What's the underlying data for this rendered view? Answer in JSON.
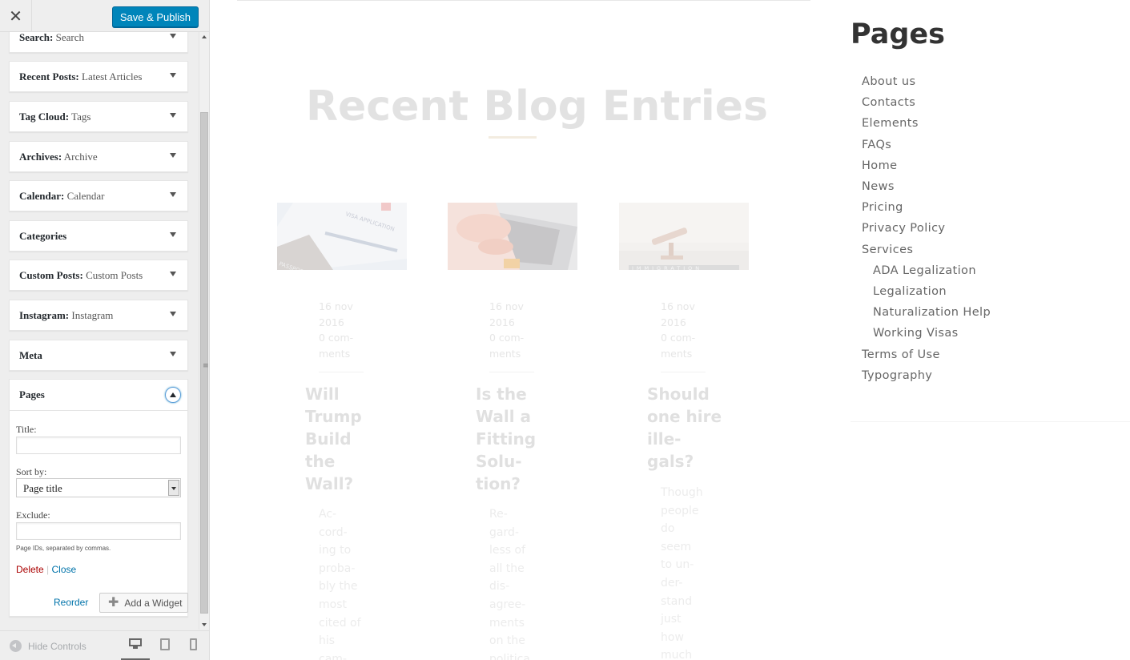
{
  "header": {
    "close_label": "✕",
    "publish_label": "Save & Publish"
  },
  "widgets": [
    {
      "title": "Search",
      "subtitle": "Search"
    },
    {
      "title": "Recent Posts",
      "subtitle": "Latest Articles"
    },
    {
      "title": "Tag Cloud",
      "subtitle": "Tags"
    },
    {
      "title": "Archives",
      "subtitle": "Archive"
    },
    {
      "title": "Calendar",
      "subtitle": "Calendar"
    },
    {
      "title": "Categories",
      "subtitle": ""
    },
    {
      "title": "Custom Posts",
      "subtitle": "Custom Posts"
    },
    {
      "title": "Instagram",
      "subtitle": "Instagram"
    },
    {
      "title": "Meta",
      "subtitle": ""
    }
  ],
  "pages_widget": {
    "title": "Pages",
    "title_label": "Title:",
    "title_value": "",
    "sort_label": "Sort by:",
    "sort_value": "Page title",
    "exclude_label": "Exclude:",
    "exclude_value": "",
    "description": "Page IDs, separated by commas.",
    "delete_label": "Delete",
    "separator": " | ",
    "close_label": "Close"
  },
  "actions": {
    "reorder_label": "Reorder",
    "add_widget_label": "Add a Widget"
  },
  "footer": {
    "hide_controls_label": "Hide Controls"
  },
  "preview": {
    "heading": "Recent Blog Entries",
    "posts": [
      {
        "date_lines": [
          "16 nov",
          "2016"
        ],
        "comments_lines": [
          "0 com-",
          "ments"
        ],
        "title_lines": [
          "Will",
          "Trump",
          "Build",
          "the",
          "Wall?"
        ],
        "excerpt_lines": [
          "Ac-",
          "cord-",
          "ing to",
          "proba-",
          "bly the",
          "most",
          "cited of",
          "his",
          "cam-"
        ]
      },
      {
        "date_lines": [
          "16 nov",
          "2016"
        ],
        "comments_lines": [
          "0 com-",
          "ments"
        ],
        "title_lines": [
          "Is the",
          "Wall a",
          "Fitting",
          "Solu-",
          "tion?"
        ],
        "excerpt_lines": [
          "Re-",
          "gard-",
          "less of",
          "all the",
          "dis-",
          "agree-",
          "ments",
          "on the",
          "politica"
        ]
      },
      {
        "date_lines": [
          "16 nov",
          "2016"
        ],
        "comments_lines": [
          "0 com-",
          "ments"
        ],
        "title_lines": [
          "Should",
          "one hire",
          "ille-",
          "gals?"
        ],
        "excerpt_lines": [
          "Though",
          "people",
          "do",
          "seem",
          "to un-",
          "der-",
          "stand",
          "just",
          "how",
          "much"
        ]
      }
    ],
    "sidebar_title": "Pages",
    "pages": [
      {
        "label": "About us",
        "child": false
      },
      {
        "label": "Contacts",
        "child": false
      },
      {
        "label": "Elements",
        "child": false
      },
      {
        "label": "FAQs",
        "child": false
      },
      {
        "label": "Home",
        "child": false
      },
      {
        "label": "News",
        "child": false
      },
      {
        "label": "Pricing",
        "child": false
      },
      {
        "label": "Privacy Policy",
        "child": false
      },
      {
        "label": "Services",
        "child": false
      },
      {
        "label": "ADA Legalization",
        "child": true
      },
      {
        "label": "Legalization",
        "child": true
      },
      {
        "label": "Naturalization Help",
        "child": true
      },
      {
        "label": "Working Visas",
        "child": true
      },
      {
        "label": "Terms of Use",
        "child": false
      },
      {
        "label": "Typography",
        "child": false
      }
    ]
  },
  "colors": {
    "accent": "#0085ba",
    "link": "#0073aa",
    "delete": "#a00000"
  }
}
